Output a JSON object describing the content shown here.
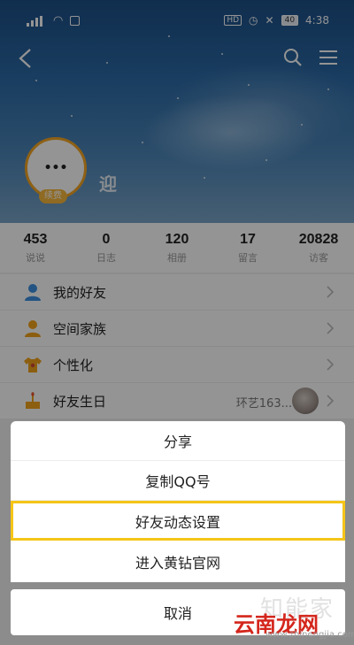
{
  "status_bar": {
    "signal": "4G",
    "time": "4:38",
    "battery": "40",
    "hd": "HD"
  },
  "profile": {
    "nickname": "迎",
    "vip_badge": "续费",
    "avatar_text": "•••"
  },
  "stats": [
    {
      "value": "453",
      "label": "说说"
    },
    {
      "value": "0",
      "label": "日志"
    },
    {
      "value": "120",
      "label": "相册"
    },
    {
      "value": "17",
      "label": "留言"
    },
    {
      "value": "20828",
      "label": "访客"
    }
  ],
  "menu": {
    "items": [
      {
        "label": "我的好友",
        "icon": "friends-icon"
      },
      {
        "label": "空间家族",
        "icon": "family-icon"
      },
      {
        "label": "个性化",
        "icon": "shirt-icon"
      },
      {
        "label": "好友生日",
        "icon": "cake-icon",
        "extra": "环艺163..."
      }
    ]
  },
  "action_sheet": {
    "options": [
      "分享",
      "复制QQ号",
      "好友动态设置",
      "进入黄钻官网"
    ],
    "cancel": "取消",
    "highlighted_index": 2
  },
  "watermark": {
    "top": "知能家",
    "brand": "云南龙网",
    "url": "www.zhinengjia.com"
  },
  "colors": {
    "accent_orange": "#f5a623",
    "highlight_yellow": "#f5c518",
    "watermark_red": "#d4261c"
  }
}
